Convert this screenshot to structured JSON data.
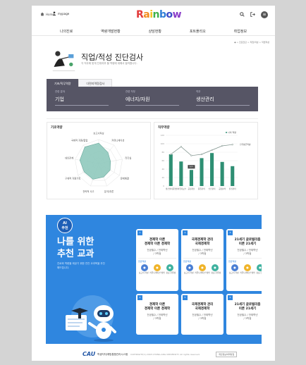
{
  "header": {
    "home_label": "Home",
    "user_label": "mypage",
    "logo_letters": [
      "R",
      "a",
      "i",
      "n",
      "b",
      "o",
      "w"
    ],
    "logo_colors": [
      "#e23a3a",
      "#f28c1e",
      "#f2c21e",
      "#3fb24a",
      "#2e7ed6",
      "#3b4cc8",
      "#8a3cc8"
    ]
  },
  "nav": {
    "items": [
      "나의진로",
      "역량개발현황",
      "상담현황",
      "포트폴리오",
      "취업정보"
    ]
  },
  "breadcrumb": "◆ > 진로진단 > 직업/적성 > 직업적성",
  "page": {
    "title": "직업/적성 진단검사",
    "subtitle": "각 직무에 맞게 진취여부 할 역량에 대해서 알려줍니다."
  },
  "tabs": [
    {
      "label": "기초/직무역량",
      "active": true
    },
    {
      "label": "다면지역량검사",
      "active": false
    }
  ],
  "fields": [
    {
      "label": "관련 분야",
      "value": "기업"
    },
    {
      "label": "관련 직무",
      "value": "에너지/자원"
    },
    {
      "label": "직무",
      "value": "생산관리"
    }
  ],
  "radar": {
    "title": "기초역량",
    "axes": [
      "보고서작성",
      "커뮤니케이션",
      "리더십",
      "문제해결",
      "분석/추론",
      "전략적 사고",
      "구체적 자원기획",
      "대인관계",
      "국제적 자원/협업"
    ],
    "values": [
      0.85,
      0.6,
      0.5,
      0.55,
      0.6,
      0.7,
      0.7,
      0.8,
      0.9
    ],
    "fill_color": "#8fc9bd"
  },
  "chart_data": {
    "type": "bar",
    "title": "직무역량",
    "legend": "나의 역량",
    "categories": [
      "생산설비운영",
      "설비유지보수",
      "공정개선",
      "품질관리",
      "안전관리",
      "공정분석",
      "환경관리"
    ],
    "values": [
      75,
      58,
      38,
      66,
      78,
      57,
      47
    ],
    "line_values": [
      75,
      93,
      72,
      75,
      85,
      95,
      98
    ],
    "highlight_index": 2,
    "highlight_label": "56%",
    "bar_color": "#2e8f73",
    "line_color": "#7a8f88",
    "ylim": [
      0,
      120
    ],
    "right_label": "전국평균역량"
  },
  "banner": {
    "ai_line1": "AI",
    "ai_line2": "추천",
    "title_line1": "나를 위한",
    "title_line2": "추천 교과",
    "desc": "진로와 역량을 제공기 위한 연관 교과목을 추천해드립니다.",
    "cards": [
      {
        "num": "1",
        "title": "경제학 이론\n경제학 이론 경제학",
        "sub": "전공필수 / 전제학년\n/ 3학점",
        "label": "연관역량"
      },
      {
        "num": "2",
        "title": "국제경제학 관리\n국제경제학",
        "sub": "전공필수 / 전제학년\n/ 3학점",
        "label": "연관역량"
      },
      {
        "num": "3",
        "title": "21세기 글로벌리즘\n이론 21세기",
        "sub": "전공필수 / 전제학년\n/ 3학점",
        "label": "연관역량"
      },
      {
        "num": "4",
        "title": "경제학 이론\n경제학 이론 경제학",
        "sub": "전공필수 / 전제학년\n/ 3학점"
      },
      {
        "num": "5",
        "title": "국제경제학 관리\n국제경제학",
        "sub": "전공필수 / 전제학년\n/ 3학점"
      },
      {
        "num": "6",
        "title": "21세기 글로벌리즘\n이론 21세기",
        "sub": "전공필수 / 전제학년\n/ 3학점"
      }
    ],
    "icon_labels": [
      "보고서 작성",
      "커뮤니케이션 방법",
      "정보 한줄성"
    ],
    "icon_colors": [
      "#4a7fd4",
      "#f0b429",
      "#3fb2a0"
    ]
  },
  "footer": {
    "logo": "CAU",
    "name": "학생지지/예방통합관리시스템",
    "copyright": "COPYRIGHT(C) 2018 CHUNG-ANG UNIVERSITY. All rights reserved.",
    "button": "개인정보처리방침"
  }
}
